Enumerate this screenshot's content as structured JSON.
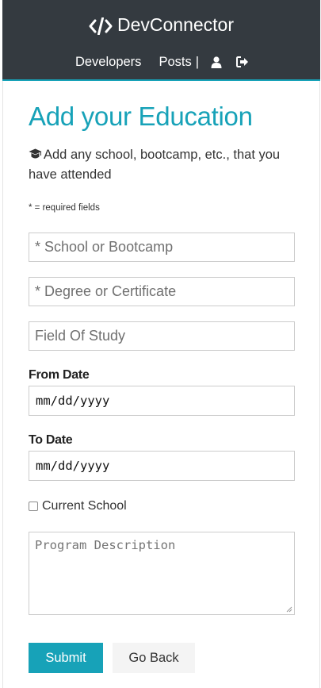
{
  "navbar": {
    "brand": "DevConnector",
    "links": [
      "Developers",
      "Posts"
    ],
    "separator": "|",
    "accent_color": "#17a2b8",
    "icons": [
      "code-icon",
      "user-icon",
      "sign-out-icon"
    ]
  },
  "page": {
    "title": "Add your Education",
    "lead": "Add any school, bootcamp, etc., that you have attended",
    "lead_icon": "graduation-cap-icon",
    "required_note": "* = required fields"
  },
  "form": {
    "school_placeholder": "* School or Bootcamp",
    "degree_placeholder": "* Degree or Certificate",
    "field_placeholder": "Field Of Study",
    "from_label": "From Date",
    "from_value": "mm/dd/yyyy",
    "to_label": "To Date",
    "to_value": "mm/dd/yyyy",
    "current_label": "Current School",
    "current_checked": false,
    "description_placeholder": "Program Description",
    "submit_label": "Submit",
    "back_label": "Go Back"
  }
}
